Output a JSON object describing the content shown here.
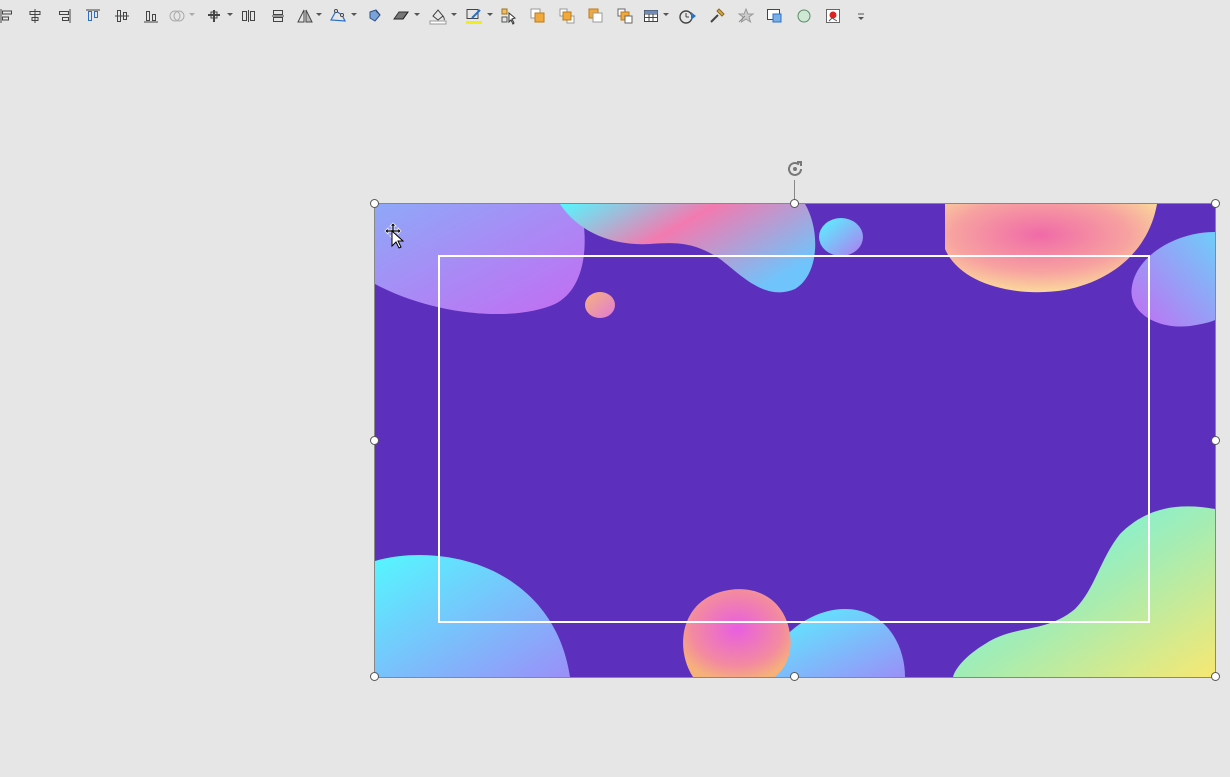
{
  "toolbar": {
    "buttons": [
      {
        "name": "align-left-icon",
        "dropdown": false
      },
      {
        "name": "align-center-icon",
        "dropdown": false
      },
      {
        "name": "align-right-icon",
        "dropdown": false
      },
      {
        "name": "align-top-icon",
        "dropdown": false
      },
      {
        "name": "align-middle-icon",
        "dropdown": false
      },
      {
        "name": "align-bottom-icon",
        "dropdown": false
      },
      {
        "name": "merge-shapes-icon",
        "dropdown": true
      },
      {
        "name": "group-icon",
        "dropdown": true
      },
      {
        "name": "distribute-horizontal-icon",
        "dropdown": false
      },
      {
        "name": "distribute-vertical-icon",
        "dropdown": false
      },
      {
        "name": "rotate-flip-icon",
        "dropdown": true
      },
      {
        "name": "edit-shape-icon",
        "dropdown": true
      },
      {
        "name": "shape-fill-icon",
        "dropdown": false
      },
      {
        "name": "shape-effects-icon",
        "dropdown": true
      },
      {
        "name": "fill-color-icon",
        "dropdown": true
      },
      {
        "name": "outline-color-icon",
        "dropdown": true
      },
      {
        "name": "selection-pane-icon",
        "dropdown": false
      },
      {
        "name": "bring-forward-icon",
        "dropdown": false
      },
      {
        "name": "bring-to-front-icon",
        "dropdown": false
      },
      {
        "name": "send-backward-icon",
        "dropdown": false
      },
      {
        "name": "send-to-back-icon",
        "dropdown": false
      },
      {
        "name": "table-icon",
        "dropdown": true
      },
      {
        "name": "animation-timing-icon",
        "dropdown": false
      },
      {
        "name": "format-painter-icon",
        "dropdown": false
      },
      {
        "name": "animation-effects-icon",
        "dropdown": false
      },
      {
        "name": "screen-capture-icon",
        "dropdown": false
      },
      {
        "name": "oval-shape-icon",
        "dropdown": false
      },
      {
        "name": "insert-picture-icon",
        "dropdown": false
      },
      {
        "name": "customize-toolbar-icon",
        "dropdown": false
      }
    ]
  },
  "colors": {
    "slide_background": "#5d2fbd",
    "frame": "#ffffff",
    "blob_cyan": "#55f7ff",
    "blob_violet": "#b06cf5",
    "blob_pink": "#f27ab0",
    "blob_yellow": "#f7e872"
  }
}
